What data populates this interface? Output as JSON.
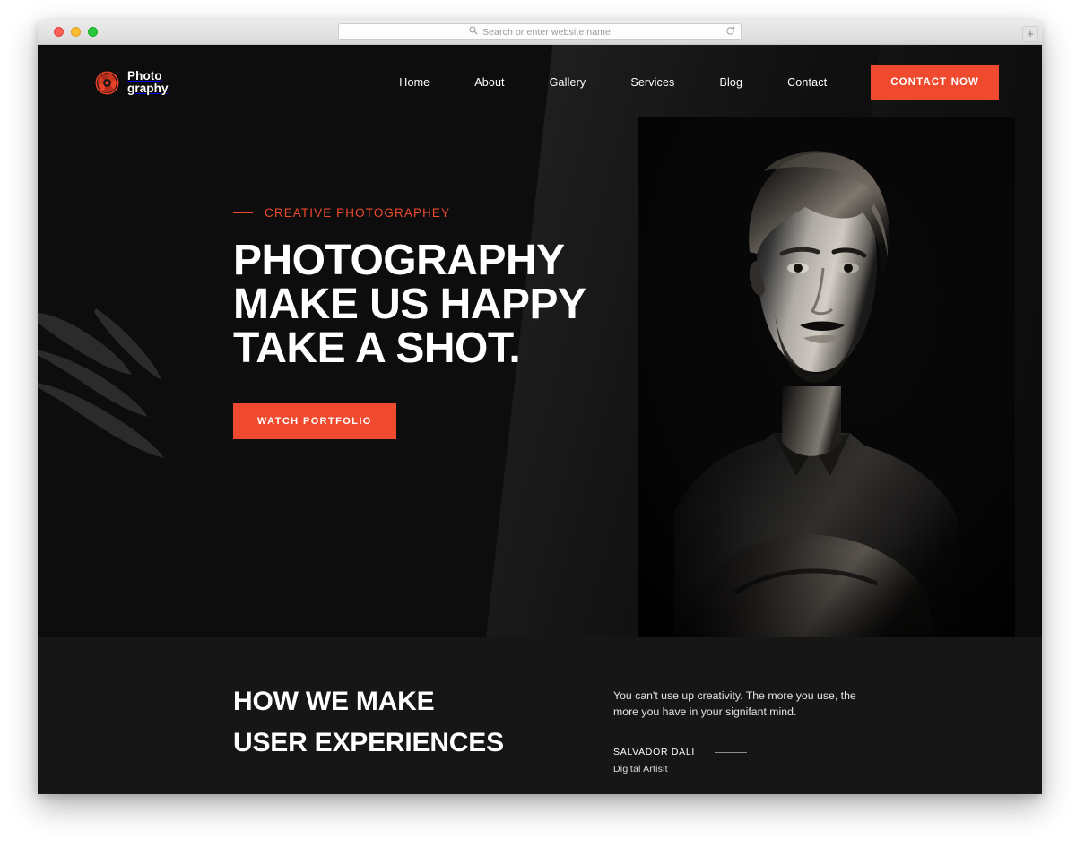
{
  "browser": {
    "traffic_lights": [
      "close",
      "minimize",
      "maximize"
    ],
    "search_placeholder": "Search or enter website name",
    "search_value": "",
    "search_icon": "search-icon",
    "reload_icon": "reload-icon",
    "newtab_label": "+"
  },
  "site": {
    "logo": {
      "icon": "camera-aperture-icon",
      "line1": "Photo",
      "line2": "graphy"
    },
    "nav": [
      {
        "label": "Home"
      },
      {
        "label": "About"
      },
      {
        "label": "Gallery"
      },
      {
        "label": "Services"
      },
      {
        "label": "Blog"
      },
      {
        "label": "Contact"
      }
    ],
    "cta_label": "CONTACT NOW",
    "accent_color": "#ef4a2e",
    "background_color": "#0d0d0d"
  },
  "hero": {
    "eyebrow": "CREATIVE PHOTOGRAPHEY",
    "title_lines": [
      "PHOTOGRAPHY",
      "MAKE US HAPPY",
      "TAKE A SHOT."
    ],
    "button_label": "WATCH PORTFOLIO",
    "image_alt": "black and white portrait of a man with crossed arms"
  },
  "section_two": {
    "heading_lines": [
      "HOW WE MAKE",
      "USER EXPERIENCES"
    ],
    "quote": "You can't use up creativity. The more you use, the more you have in your signifant mind.",
    "author": "SALVADOR DALI",
    "author_role": "Digital Artisit"
  }
}
